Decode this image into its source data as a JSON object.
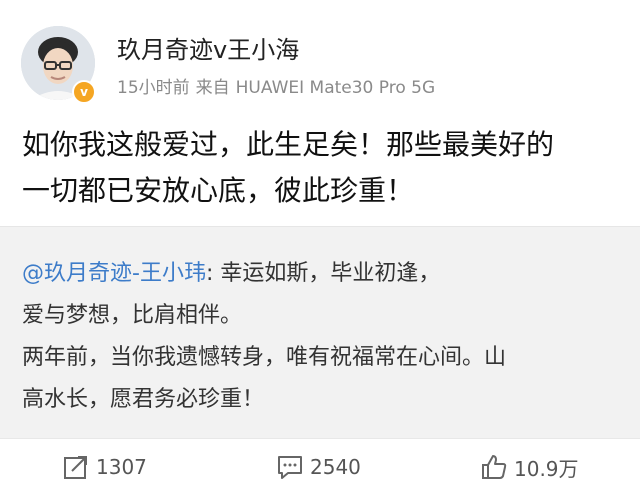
{
  "post": {
    "author": "玖月奇迹v王小海",
    "time": "15小时前",
    "source_prefix": "来自",
    "source_device": "HUAWEI Mate30 Pro 5G",
    "verified_badge": "v",
    "text_lines": [
      "如你我这般爱过，此生足矣！那些最美好的",
      "一切都已安放心底，彼此珍重！"
    ]
  },
  "repost": {
    "mention": "@玖月奇迹-王小玮",
    "line1_rest": ": 幸运如斯，毕业初逢，",
    "line2": "爱与梦想，比肩相伴。",
    "line3": "两年前，当你我遗憾转身，唯有祝福常在心间。山",
    "line4": "高水长，愿君务必珍重！"
  },
  "actions": {
    "repost_count": "1307",
    "comment_count": "2540",
    "like_count": "10.9万"
  },
  "icons": {
    "repost": "share-icon",
    "comment": "comment-icon",
    "like": "thumbs-up-icon",
    "verified": "verified-badge-icon"
  },
  "colors": {
    "mention": "#3d7cc9",
    "verified": "#f5a623",
    "repost_bg": "#f2f2f2"
  }
}
